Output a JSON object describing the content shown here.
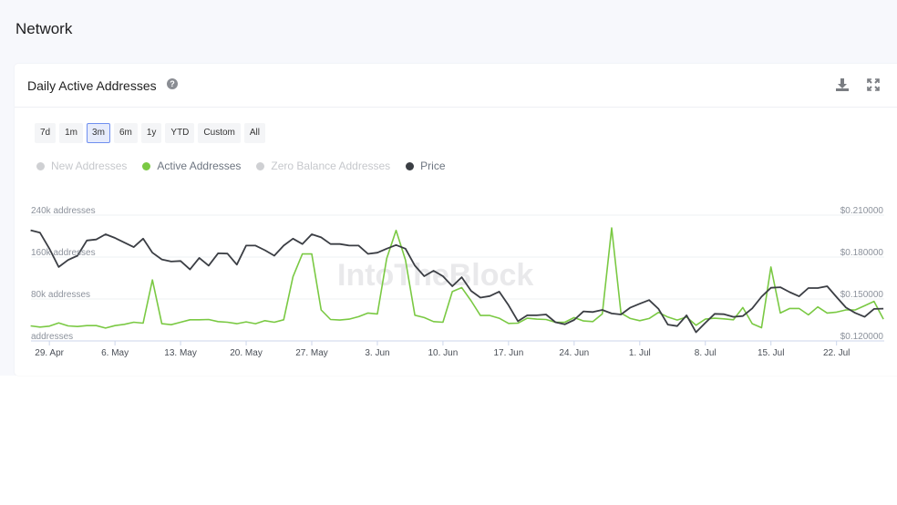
{
  "page": {
    "section_title": "Network"
  },
  "card": {
    "title": "Daily Active Addresses",
    "help_icon": "question-circle-icon",
    "download_icon": "download-icon",
    "fullscreen_icon": "expand-icon"
  },
  "ranges": [
    {
      "label": "7d"
    },
    {
      "label": "1m"
    },
    {
      "label": "3m",
      "active": true
    },
    {
      "label": "6m"
    },
    {
      "label": "1y"
    },
    {
      "label": "YTD"
    },
    {
      "label": "Custom"
    },
    {
      "label": "All"
    }
  ],
  "legend": [
    {
      "label": "New Addresses",
      "enabled": false
    },
    {
      "label": "Active Addresses",
      "enabled": true,
      "color": "#7ac943"
    },
    {
      "label": "Zero Balance Addresses",
      "enabled": false
    },
    {
      "label": "Price",
      "enabled": true,
      "color": "#3b3e44"
    }
  ],
  "watermark": "IntoTheBlock",
  "chart_data": {
    "type": "line",
    "grid": true,
    "legend_placement": "top-left",
    "x_ticks": [
      "29. Apr",
      "6. May",
      "13. May",
      "20. May",
      "27. May",
      "3. Jun",
      "10. Jun",
      "17. Jun",
      "24. Jun",
      "1. Jul",
      "8. Jul",
      "15. Jul",
      "22. Jul"
    ],
    "x_tick_dates": [
      "29 Apr",
      "6 May",
      "13 May",
      "20 May",
      "27 May",
      "3 Jun",
      "10 Jun",
      "17 Jun",
      "24 Jun",
      "1 Jul",
      "8 Jul",
      "15 Jul",
      "22 Jul"
    ],
    "y_left": {
      "ticks": [
        "addresses",
        "80k addresses",
        "160k addresses",
        "240k addresses"
      ],
      "tick_values": [
        0,
        80000,
        160000,
        240000
      ],
      "range": [
        0,
        240000
      ]
    },
    "y_right": {
      "ticks": [
        "$0.120000",
        "$0.150000",
        "$0.180000",
        "$0.210000"
      ],
      "tick_values": [
        0.12,
        0.15,
        0.18,
        0.21
      ],
      "range": [
        0.12,
        0.21
      ]
    },
    "x": [
      "27 Apr",
      "28 Apr",
      "29 Apr",
      "30 Apr",
      "1 May",
      "2 May",
      "3 May",
      "4 May",
      "5 May",
      "6 May",
      "7 May",
      "8 May",
      "9 May",
      "10 May",
      "11 May",
      "12 May",
      "13 May",
      "14 May",
      "15 May",
      "16 May",
      "17 May",
      "18 May",
      "19 May",
      "20 May",
      "21 May",
      "22 May",
      "23 May",
      "24 May",
      "25 May",
      "26 May",
      "27 May",
      "28 May",
      "29 May",
      "30 May",
      "31 May",
      "1 Jun",
      "2 Jun",
      "3 Jun",
      "4 Jun",
      "5 Jun",
      "6 Jun",
      "7 Jun",
      "8 Jun",
      "9 Jun",
      "10 Jun",
      "11 Jun",
      "12 Jun",
      "13 Jun",
      "14 Jun",
      "15 Jun",
      "16 Jun",
      "17 Jun",
      "18 Jun",
      "19 Jun",
      "20 Jun",
      "21 Jun",
      "22 Jun",
      "23 Jun",
      "24 Jun",
      "25 Jun",
      "26 Jun",
      "27 Jun",
      "28 Jun",
      "29 Jun",
      "30 Jun",
      "1 Jul",
      "2 Jul",
      "3 Jul",
      "4 Jul",
      "5 Jul",
      "6 Jul",
      "7 Jul",
      "8 Jul",
      "9 Jul",
      "10 Jul",
      "11 Jul",
      "12 Jul",
      "13 Jul",
      "14 Jul",
      "15 Jul",
      "16 Jul",
      "17 Jul",
      "18 Jul",
      "19 Jul",
      "20 Jul",
      "21 Jul",
      "22 Jul",
      "23 Jul",
      "24 Jul",
      "25 Jul",
      "26 Jul",
      "27 Jul"
    ],
    "series": [
      {
        "name": "Active Addresses",
        "axis": "left",
        "color": "#7ac943",
        "values": [
          28700,
          26400,
          28100,
          34500,
          28700,
          27500,
          29300,
          29300,
          24600,
          29300,
          31600,
          35700,
          33900,
          116300,
          32800,
          31000,
          35700,
          40400,
          40400,
          40900,
          36900,
          35700,
          32800,
          36300,
          32800,
          38600,
          35700,
          40400,
          122500,
          166000,
          166000,
          59100,
          40900,
          39800,
          41500,
          46200,
          53200,
          51500,
          157300,
          211000,
          154400,
          49100,
          44500,
          36900,
          35700,
          94100,
          101700,
          76600,
          48500,
          48500,
          43300,
          33400,
          33900,
          43300,
          41500,
          40900,
          35700,
          35700,
          44500,
          38000,
          36900,
          51500,
          215500,
          53200,
          42700,
          38600,
          42700,
          54400,
          45600,
          39800,
          45600,
          29900,
          41500,
          43300,
          42100,
          40400,
          63700,
          32800,
          25200,
          141000,
          53200,
          62000,
          62000,
          49700,
          64900,
          53200,
          55000,
          59100,
          59100,
          67200,
          75400,
          41500
        ]
      },
      {
        "name": "Price",
        "axis": "right",
        "color": "#3b3e44",
        "values": [
          0.1992,
          0.1974,
          0.186,
          0.1729,
          0.1779,
          0.181,
          0.1919,
          0.1926,
          0.1963,
          0.1937,
          0.1904,
          0.1871,
          0.1932,
          0.1831,
          0.1783,
          0.1768,
          0.1772,
          0.1711,
          0.1794,
          0.1739,
          0.1827,
          0.1825,
          0.1746,
          0.1882,
          0.1882,
          0.1849,
          0.181,
          0.1882,
          0.1932,
          0.1893,
          0.1963,
          0.1941,
          0.1893,
          0.1893,
          0.1882,
          0.1882,
          0.1823,
          0.1831,
          0.186,
          0.1886,
          0.186,
          0.1739,
          0.1663,
          0.1702,
          0.1663,
          0.1591,
          0.1656,
          0.1558,
          0.151,
          0.1521,
          0.1553,
          0.1455,
          0.1341,
          0.1383,
          0.1383,
          0.1389,
          0.1334,
          0.1319,
          0.135,
          0.1411,
          0.1407,
          0.1422,
          0.1396,
          0.1389,
          0.1439,
          0.1466,
          0.1492,
          0.1429,
          0.1317,
          0.1306,
          0.1383,
          0.1262,
          0.133,
          0.1394,
          0.1391,
          0.1372,
          0.1378,
          0.1433,
          0.1516,
          0.158,
          0.1584,
          0.1549,
          0.1519,
          0.1578,
          0.1578,
          0.1591,
          0.1514,
          0.1439,
          0.14,
          0.1372,
          0.1429,
          0.1431
        ]
      }
    ]
  }
}
